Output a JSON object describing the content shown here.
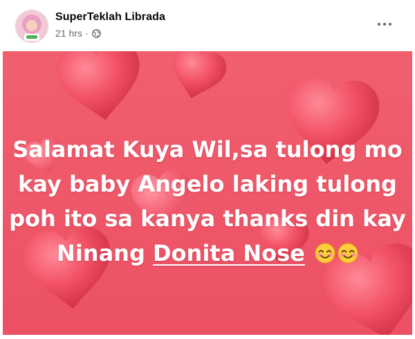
{
  "post": {
    "author": "SuperTeklah Librada",
    "time": "21 hrs",
    "separator": "·",
    "privacy_icon": "globe-icon",
    "more_icon": "more-options-icon",
    "avatar_icon": "profile-avatar"
  },
  "status": {
    "text_before": "Salamat Kuya Wil,sa tulong mo kay baby Angelo laking tulong poh ito sa kanya thanks din kay Ninang ",
    "mention": "Donita Nose",
    "emojis": [
      "smiling-face-emoji",
      "smiling-face-emoji"
    ],
    "text_color": "#ffffff",
    "background_color": "#ef5a6a",
    "background_pattern": "hearts"
  }
}
